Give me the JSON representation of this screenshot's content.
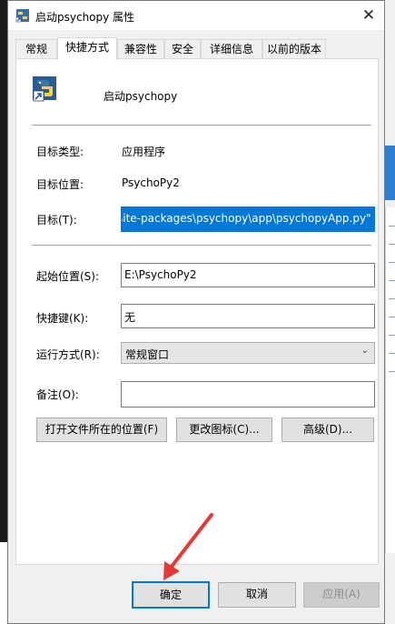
{
  "window": {
    "title": "启动psychopy 属性",
    "close_icon": "close-icon"
  },
  "tabs": [
    {
      "label": "常规"
    },
    {
      "label": "快捷方式"
    },
    {
      "label": "兼容性"
    },
    {
      "label": "安全"
    },
    {
      "label": "详细信息"
    },
    {
      "label": "以前的版本"
    }
  ],
  "active_tab": "快捷方式",
  "shortcut": {
    "name": "启动psychopy",
    "target_type_label": "目标类型:",
    "target_type_value": "应用程序",
    "target_location_label": "目标位置:",
    "target_location_value": "PsychoPy2",
    "target_label": "目标(T):",
    "target_value": "site-packages\\psychopy\\app\\psychopyApp.py\"",
    "start_in_label": "起始位置(S):",
    "start_in_value": "E:\\PsychoPy2",
    "hotkey_label": "快捷键(K):",
    "hotkey_value": "无",
    "run_label": "运行方式(R):",
    "run_value": "常规窗口",
    "comment_label": "备注(O):",
    "comment_value": ""
  },
  "actions": {
    "open_location": "打开文件所在的位置(F)",
    "change_icon": "更改图标(C)...",
    "advanced": "高级(D)..."
  },
  "footer": {
    "ok": "确定",
    "cancel": "取消",
    "apply": "应用(A)"
  },
  "colors": {
    "selection": "#0078d7",
    "annotation_arrow": "#e53935"
  }
}
